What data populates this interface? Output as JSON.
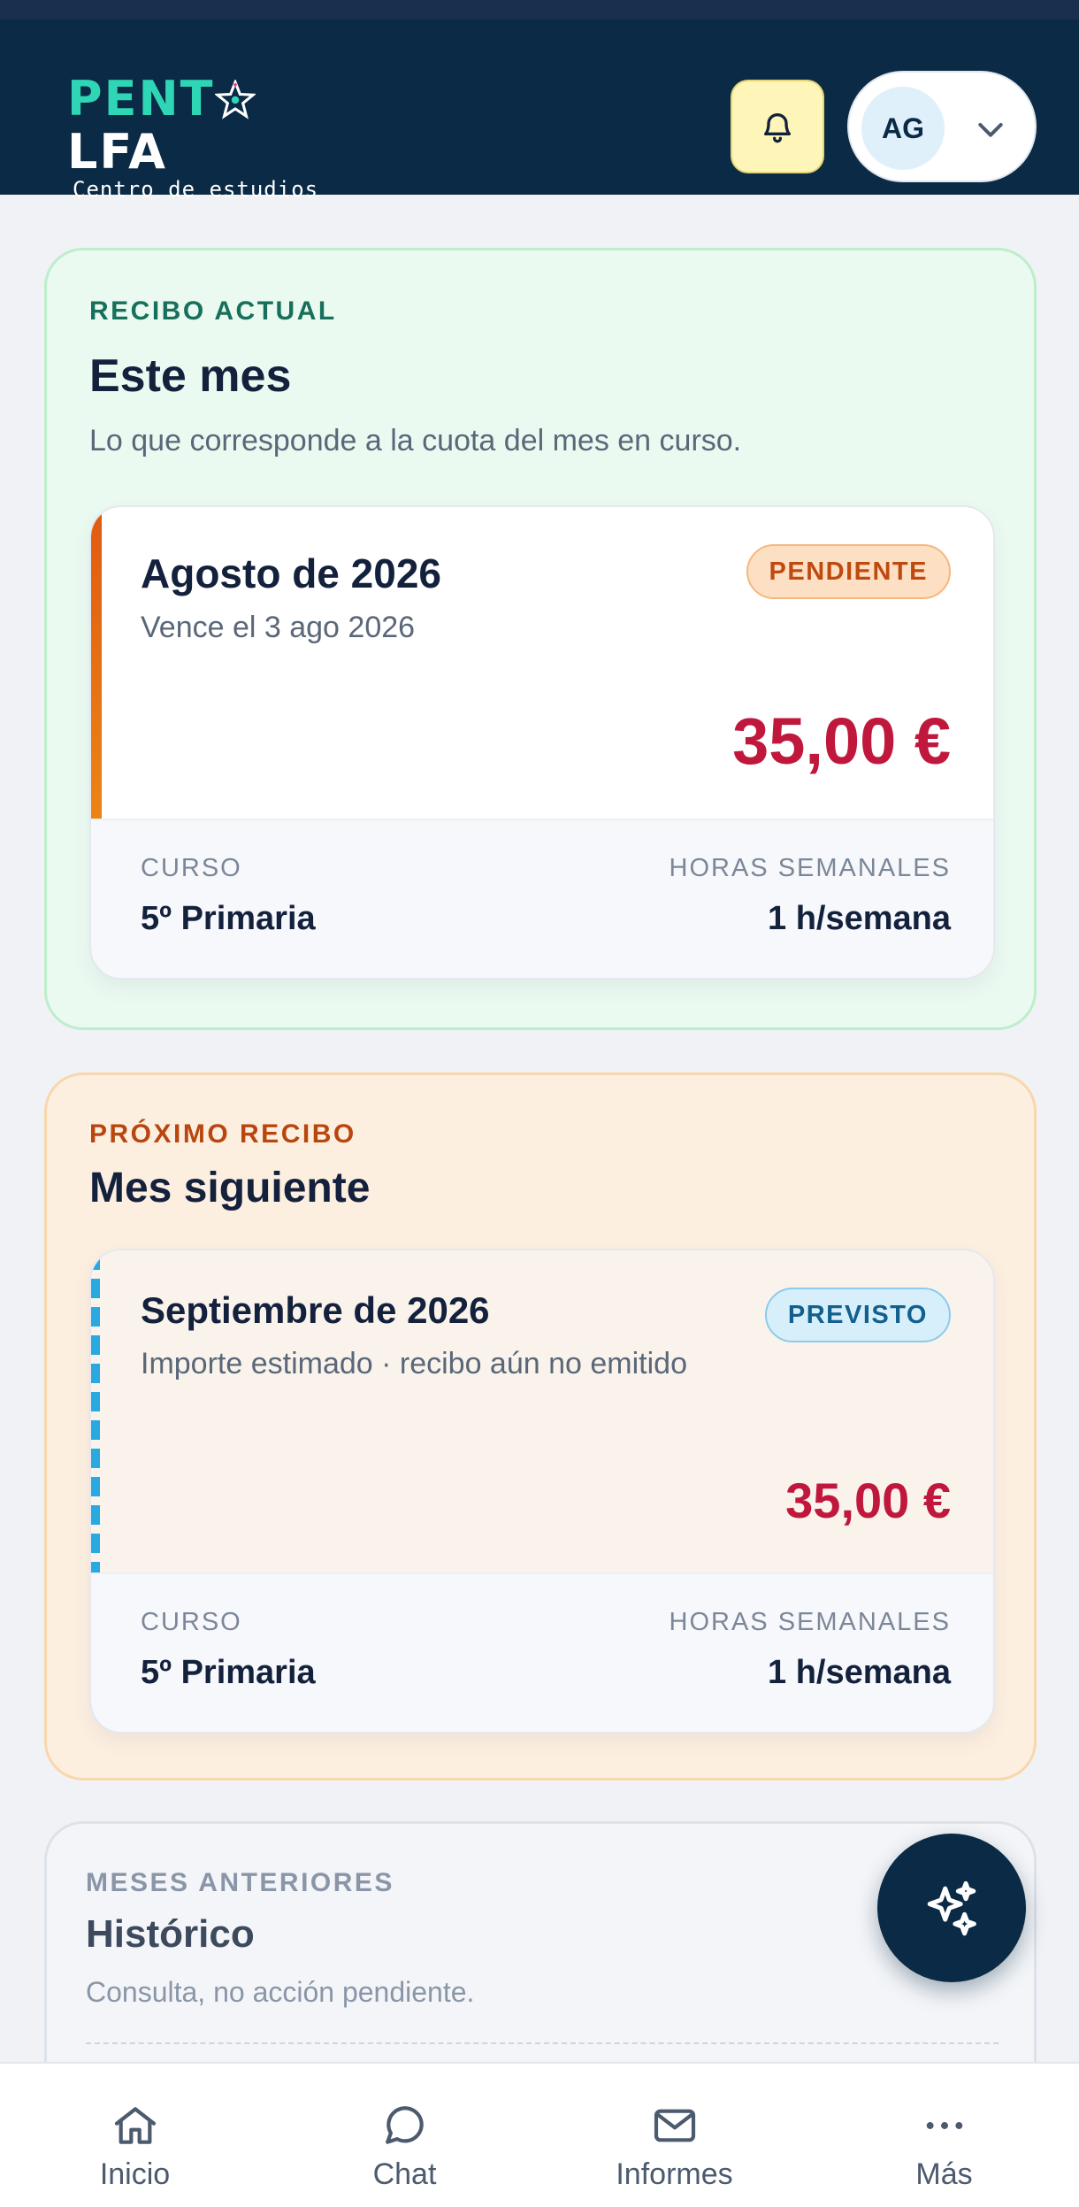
{
  "header": {
    "logo": {
      "word_a": "PENT",
      "word_b": "LFA",
      "subtitle": "Centro de estudios"
    },
    "notifications_icon": "bell-icon",
    "profile": {
      "initials": "AG",
      "menu_icon": "chevron-down-icon"
    }
  },
  "current": {
    "eyebrow": "RECIBO ACTUAL",
    "title": "Este mes",
    "description": "Lo que corresponde a la cuota del mes en curso.",
    "card": {
      "month": "Agosto de 2026",
      "due": "Vence el 3 ago 2026",
      "status": "PENDIENTE",
      "amount": "35,00 €",
      "course_label": "CURSO",
      "course_value": "5º Primaria",
      "hours_label": "HORAS SEMANALES",
      "hours_value": "1 h/semana"
    }
  },
  "next": {
    "eyebrow": "PRÓXIMO RECIBO",
    "title": "Mes siguiente",
    "card": {
      "month": "Septiembre de 2026",
      "note": "Importe estimado · recibo aún no emitido",
      "status": "PREVISTO",
      "amount": "35,00 €",
      "course_label": "CURSO",
      "course_value": "5º Primaria",
      "hours_label": "HORAS SEMANALES",
      "hours_value": "1 h/semana"
    }
  },
  "history": {
    "eyebrow": "MESES ANTERIORES",
    "title": "Histórico",
    "description": "Consulta, no acción pendiente."
  },
  "fab_icon": "sparkles-icon",
  "nav": [
    {
      "label": "Inicio",
      "icon": "home-icon"
    },
    {
      "label": "Chat",
      "icon": "chat-bubble-icon"
    },
    {
      "label": "Informes",
      "icon": "mail-icon"
    },
    {
      "label": "Más",
      "icon": "more-horizontal-icon"
    }
  ],
  "colors": {
    "header_bg": "#0b2a45",
    "current_panel": "#ebfaf1",
    "next_panel": "#fdefe0",
    "amount": "#c0183c",
    "pending_badge": "#fde0c4",
    "planned_badge": "#d7effa"
  }
}
